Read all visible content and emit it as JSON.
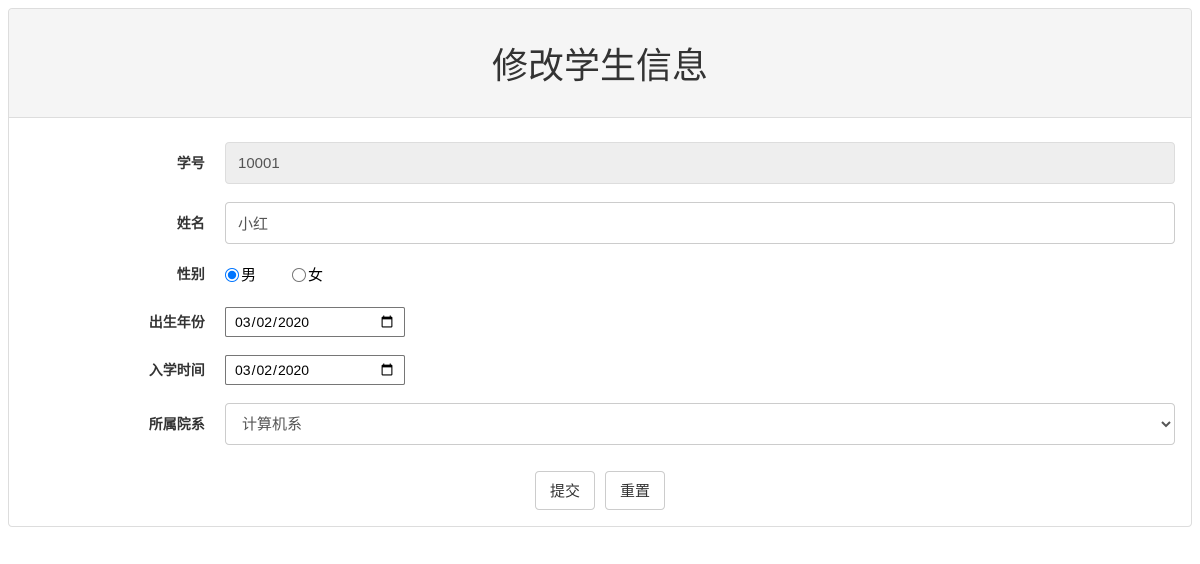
{
  "header": {
    "title": "修改学生信息"
  },
  "form": {
    "student_id": {
      "label": "学号",
      "value": "10001"
    },
    "name": {
      "label": "姓名",
      "value": "小红"
    },
    "gender": {
      "label": "性别",
      "options": {
        "male": "男",
        "female": "女"
      },
      "selected": "male"
    },
    "birth_year": {
      "label": "出生年份",
      "value": "2020-03-02"
    },
    "enroll_date": {
      "label": "入学时间",
      "value": "2020-03-02"
    },
    "department": {
      "label": "所属院系",
      "selected": "计算机系",
      "options": [
        "计算机系"
      ]
    }
  },
  "buttons": {
    "submit": "提交",
    "reset": "重置"
  }
}
